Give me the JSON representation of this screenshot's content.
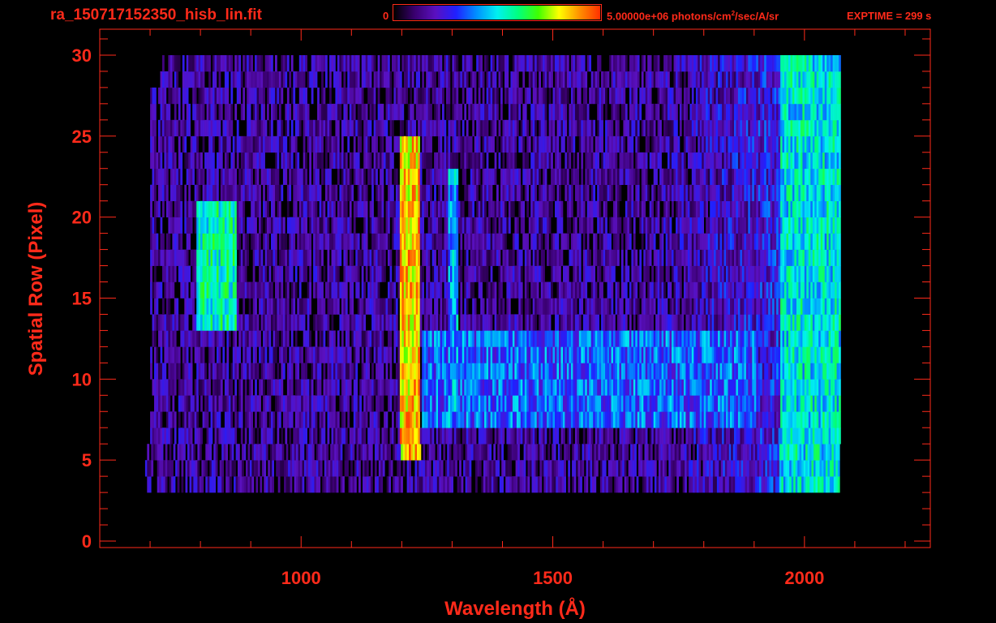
{
  "header": {
    "filename": "ra_150717152350_hisb_lin.fit",
    "colorbar_min": "0",
    "colorbar_max_label_pre": "5.00000e+06 photons/cm",
    "colorbar_max_label_sup": "2",
    "colorbar_max_label_post": "/sec/A/sr",
    "exptime": "EXPTIME = 299 s"
  },
  "colors": {
    "axis": "#ff2a1a",
    "background": "#000000",
    "colormap": [
      "#000000",
      "#3a0070",
      "#5a10c0",
      "#2020ff",
      "#0090ff",
      "#00f0f0",
      "#00ff80",
      "#40ff00",
      "#ffff00",
      "#ff9000",
      "#ff3000"
    ]
  },
  "chart_data": {
    "type": "heatmap",
    "xlabel": "Wavelength (Å)",
    "ylabel": "Spatial Row (Pixel)",
    "x_ticks": [
      1000,
      1500,
      2000
    ],
    "y_ticks": [
      0,
      5,
      10,
      15,
      20,
      25,
      30
    ],
    "xlim": [
      600,
      2250
    ],
    "ylim": [
      -0.4,
      31.6
    ],
    "colorbar_range": [
      0,
      5000000
    ],
    "colorbar_units": "photons/cm²/sec/A/sr",
    "signal_wavelength_range": [
      700,
      2070
    ],
    "signal_row_range": [
      3,
      30
    ],
    "features": [
      {
        "wavelength_range": [
          790,
          870
        ],
        "rows": [
          13,
          20
        ],
        "level": 0.55
      },
      {
        "wavelength_range": [
          1195,
          1235
        ],
        "rows": [
          5,
          24
        ],
        "level": 0.85
      },
      {
        "wavelength_range": [
          1290,
          1310
        ],
        "rows": [
          7,
          22
        ],
        "level": 0.42
      },
      {
        "wavelength_range": [
          1240,
          1900
        ],
        "rows": [
          7,
          12
        ],
        "level": 0.35
      },
      {
        "wavelength_range": [
          1950,
          2070
        ],
        "rows": [
          3,
          30
        ],
        "level": 0.5
      }
    ]
  }
}
